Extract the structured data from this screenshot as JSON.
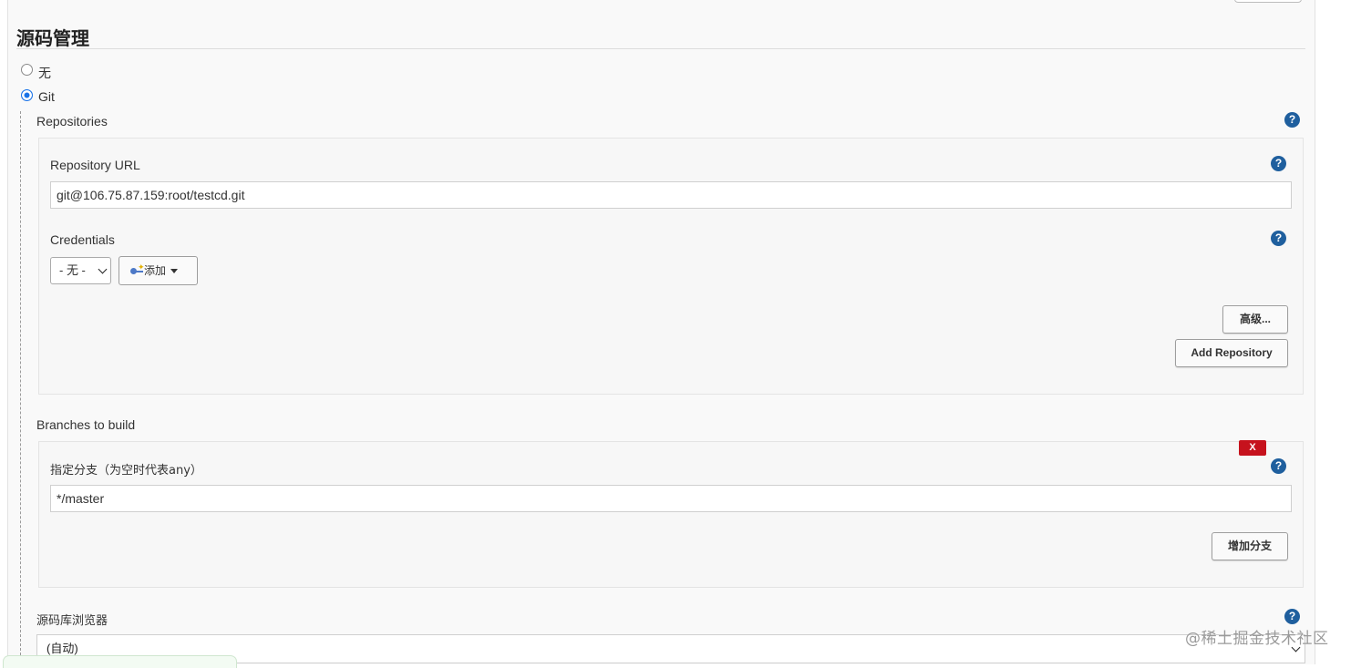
{
  "section": {
    "title": "源码管理"
  },
  "scm_options": {
    "none_label": "无",
    "git_label": "Git",
    "selected": "Git"
  },
  "repositories": {
    "label": "Repositories",
    "url_label": "Repository URL",
    "url_value": "git@106.75.87.159:root/testcd.git",
    "credentials_label": "Credentials",
    "credentials_selected": "- 无 -",
    "add_button": "添加",
    "advanced_button": "高级...",
    "add_repository_button": "Add Repository"
  },
  "branches": {
    "label": "Branches to build",
    "delete_button": "X",
    "branch_specifier_label": "指定分支（为空时代表any）",
    "branch_specifier_value": "*/master",
    "add_branch_button": "增加分支"
  },
  "repo_browser": {
    "label": "源码库浏览器",
    "selected": "(自动)"
  },
  "help_icon_glyph": "?",
  "watermark": "@稀土掘金技术社区",
  "colors": {
    "help_icon": "#1f5f9e",
    "delete_button": "#c6121d",
    "radio_selected": "#1a73e8"
  }
}
